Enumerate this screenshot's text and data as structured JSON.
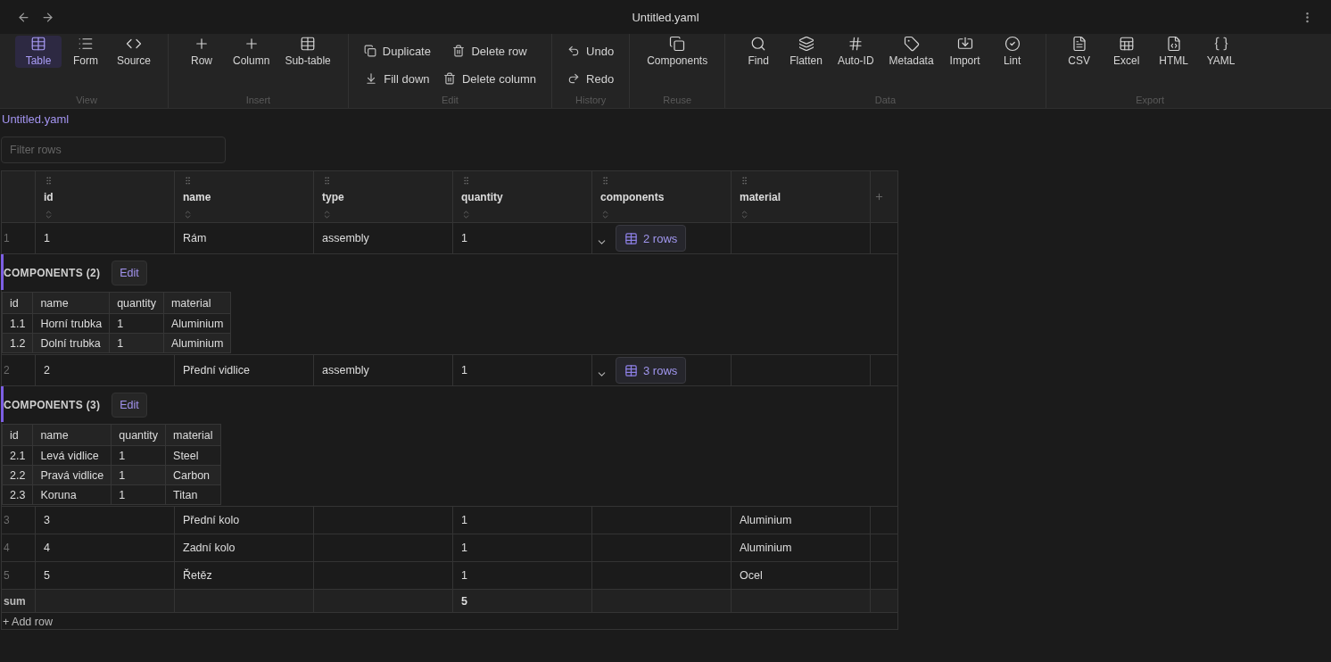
{
  "window": {
    "title": "Untitled.yaml"
  },
  "toolbar": {
    "groups": [
      {
        "label": "View",
        "kind": "large",
        "items": [
          {
            "label": "Table",
            "selected": true
          },
          {
            "label": "Form",
            "selected": false
          },
          {
            "label": "Source",
            "selected": false
          }
        ]
      },
      {
        "label": "Insert",
        "kind": "large",
        "items": [
          {
            "label": "Row"
          },
          {
            "label": "Column"
          },
          {
            "label": "Sub-table"
          }
        ]
      },
      {
        "label": "Edit",
        "kind": "compact",
        "items": [
          {
            "label": "Duplicate"
          },
          {
            "label": "Delete row"
          },
          {
            "label": "Fill down"
          },
          {
            "label": "Delete column"
          }
        ]
      },
      {
        "label": "History",
        "kind": "compact",
        "items": [
          {
            "label": "Undo"
          },
          {
            "label": "Redo"
          }
        ]
      },
      {
        "label": "Reuse",
        "kind": "large",
        "items": [
          {
            "label": "Components"
          }
        ]
      },
      {
        "label": "Data",
        "kind": "large",
        "items": [
          {
            "label": "Find"
          },
          {
            "label": "Flatten"
          },
          {
            "label": "Auto-ID"
          },
          {
            "label": "Metadata"
          },
          {
            "label": "Import"
          },
          {
            "label": "Lint"
          }
        ]
      },
      {
        "label": "Export",
        "kind": "large",
        "items": [
          {
            "label": "CSV"
          },
          {
            "label": "Excel"
          },
          {
            "label": "HTML"
          },
          {
            "label": "YAML"
          }
        ]
      }
    ]
  },
  "file_link": "Untitled.yaml",
  "filter": {
    "placeholder": "Filter rows"
  },
  "table": {
    "columns": [
      "id",
      "name",
      "type",
      "quantity",
      "components",
      "material"
    ],
    "rows": [
      {
        "number": "1",
        "id": "1",
        "name": "Rám",
        "type": "assembly",
        "quantity": "1",
        "components": {
          "expanded": true,
          "summary": "2 rows",
          "title": "COMPONENTS (2)",
          "edit": "Edit",
          "columns": [
            "id",
            "name",
            "quantity",
            "material"
          ],
          "rows": [
            {
              "id": "1.1",
              "name": "Horní trubka",
              "quantity": "1",
              "material": "Aluminium"
            },
            {
              "id": "1.2",
              "name": "Dolní trubka",
              "quantity": "1",
              "material": "Aluminium"
            }
          ]
        }
      },
      {
        "number": "2",
        "id": "2",
        "name": "Přední vidlice",
        "type": "assembly",
        "quantity": "1",
        "components": {
          "expanded": true,
          "summary": "3 rows",
          "title": "COMPONENTS (3)",
          "edit": "Edit",
          "columns": [
            "id",
            "name",
            "quantity",
            "material"
          ],
          "rows": [
            {
              "id": "2.1",
              "name": "Levá vidlice",
              "quantity": "1",
              "material": "Steel"
            },
            {
              "id": "2.2",
              "name": "Pravá vidlice",
              "quantity": "1",
              "material": "Carbon"
            },
            {
              "id": "2.3",
              "name": "Koruna",
              "quantity": "1",
              "material": "Titan"
            }
          ]
        }
      },
      {
        "number": "3",
        "id": "3",
        "name": "Přední kolo",
        "quantity": "1",
        "material": "Aluminium"
      },
      {
        "number": "4",
        "id": "4",
        "name": "Zadní kolo",
        "quantity": "1",
        "material": "Aluminium"
      },
      {
        "number": "5",
        "id": "5",
        "name": "Řetěz",
        "quantity": "1",
        "material": "Ocel"
      }
    ],
    "sum": {
      "label": "sum",
      "quantity": "5"
    },
    "add_row": "+ Add row"
  }
}
